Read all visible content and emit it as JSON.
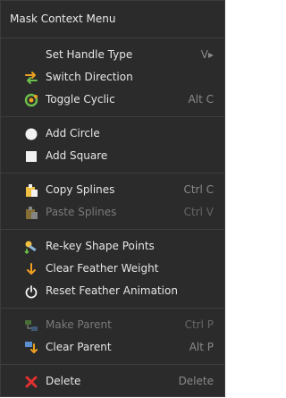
{
  "menu": {
    "title": "Mask Context Menu",
    "items": [
      {
        "label": "Set Handle Type",
        "shortcut": "V▸",
        "icon": "none",
        "enabled": true
      },
      {
        "label": "Switch Direction",
        "shortcut": "",
        "icon": "switch-direction-icon",
        "enabled": true
      },
      {
        "label": "Toggle Cyclic",
        "shortcut": "Alt C",
        "icon": "toggle-cyclic-icon",
        "enabled": true
      },
      {
        "label": "Add Circle",
        "shortcut": "",
        "icon": "circle-icon",
        "enabled": true
      },
      {
        "label": "Add Square",
        "shortcut": "",
        "icon": "square-icon",
        "enabled": true
      },
      {
        "label": "Copy Splines",
        "shortcut": "Ctrl C",
        "icon": "copy-icon",
        "enabled": true
      },
      {
        "label": "Paste Splines",
        "shortcut": "Ctrl V",
        "icon": "paste-icon",
        "enabled": false
      },
      {
        "label": "Re-key Shape Points",
        "shortcut": "",
        "icon": "rekey-icon",
        "enabled": true
      },
      {
        "label": "Clear Feather Weight",
        "shortcut": "",
        "icon": "arrow-down-icon",
        "enabled": true
      },
      {
        "label": "Reset Feather Animation",
        "shortcut": "",
        "icon": "power-icon",
        "enabled": true
      },
      {
        "label": "Make Parent",
        "shortcut": "Ctrl P",
        "icon": "make-parent-icon",
        "enabled": false
      },
      {
        "label": "Clear Parent",
        "shortcut": "Alt P",
        "icon": "clear-parent-icon",
        "enabled": true
      },
      {
        "label": "Delete",
        "shortcut": "Delete",
        "icon": "delete-x-icon",
        "enabled": true
      }
    ]
  },
  "colors": {
    "background": "#2b2b2b",
    "text": "#e6e6e6",
    "disabled_text": "#7a7a7a",
    "separator": "#3f3f3f",
    "shortcut": "#8a8a8a",
    "accent_green": "#6cc04a",
    "accent_orange": "#f0a020",
    "delete_red": "#e03030"
  }
}
